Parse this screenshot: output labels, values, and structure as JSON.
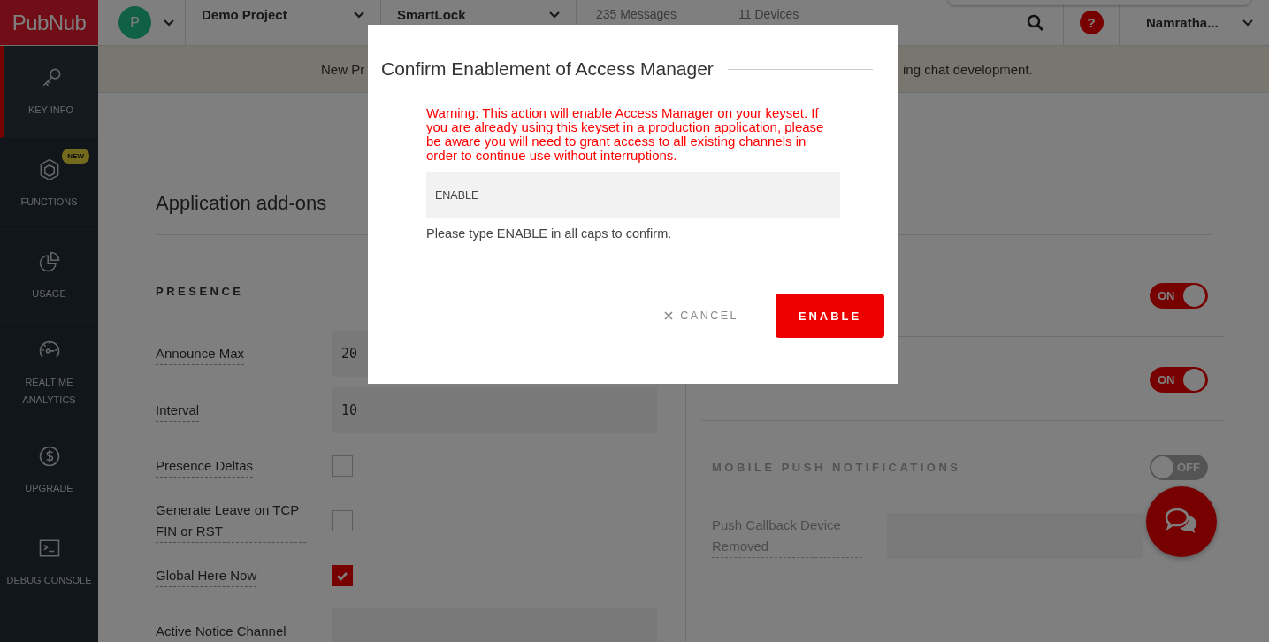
{
  "header": {
    "logo": "PubNub",
    "avatar": "P",
    "project": "Demo Project",
    "keyset": "SmartLock",
    "stats": [
      "235 Messages",
      "11 Devices"
    ],
    "help": "?",
    "user": "Namratha..."
  },
  "sidebar": {
    "items": [
      {
        "kind": "key",
        "label": "KEY INFO",
        "selected": true
      },
      {
        "kind": "functions",
        "label": "FUNCTIONS",
        "selected": false,
        "badge": "NEW"
      },
      {
        "kind": "usage",
        "label": "USAGE",
        "selected": false
      },
      {
        "kind": "analytics",
        "label": "REALTIME ANALYTICS",
        "selected": false
      },
      {
        "kind": "upgrade",
        "label": "UPGRADE",
        "selected": false
      },
      {
        "kind": "console",
        "label": "DEBUG CONSOLE",
        "selected": false
      }
    ]
  },
  "banner": {
    "left": "New Pr",
    "right": "ing chat development."
  },
  "content": {
    "title": "Application add-ons",
    "presence": {
      "heading": "PRESENCE",
      "rows": [
        {
          "kind": "field",
          "label": "Announce Max",
          "value": "20"
        },
        {
          "kind": "field",
          "label": "Interval",
          "value": "10"
        },
        {
          "kind": "checkbox",
          "label": "Presence Deltas",
          "checked": false
        },
        {
          "kind": "checkbox",
          "label": "Generate Leave on TCP FIN or RST",
          "checked": false
        },
        {
          "kind": "checkbox",
          "label": "Global Here Now",
          "checked": true
        },
        {
          "kind": "field",
          "label": "Active Notice Channel"
        }
      ]
    },
    "toggles": [
      {
        "label": "ON",
        "on": true
      },
      {
        "label": "ON",
        "on": true
      }
    ],
    "push": {
      "heading": "MOBILE PUSH NOTIFICATIONS",
      "disabled": true,
      "toggle": {
        "label": "OFF",
        "on": false
      },
      "rows": [
        {
          "label": "Push Callback Device Removed"
        }
      ]
    }
  },
  "modal": {
    "title": "Confirm Enablement of Access Manager",
    "warning": "Warning: This action will enable Access Manager on your keyset. If you are already using this keyset in a production application, please be aware you will need to grant access to all existing channels in order to continue use without interruptions.",
    "input": {
      "value": "ENABLE"
    },
    "hint": "Please type ENABLE in all caps to confirm.",
    "cancel": "CANCEL",
    "confirm": "ENABLE"
  }
}
